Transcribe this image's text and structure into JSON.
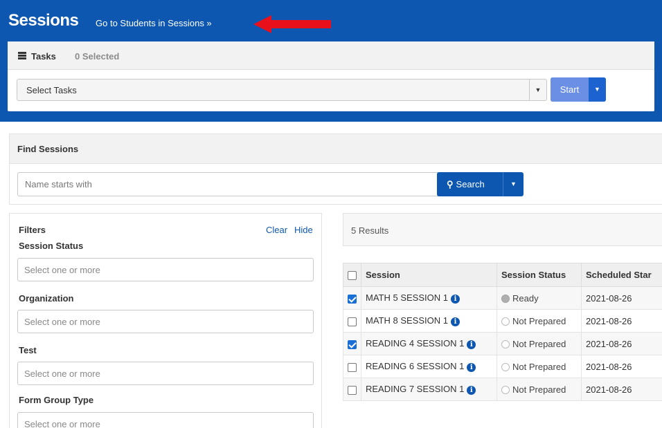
{
  "header": {
    "title": "Sessions",
    "goto_link": "Go to Students in Sessions »",
    "accent_color": "#0d57b0",
    "arrow_color": "#e8101a"
  },
  "tasks": {
    "label": "Tasks",
    "selected_count": "0 Selected",
    "select_value": "Select Tasks",
    "start_label": "Start"
  },
  "find": {
    "title": "Find Sessions",
    "search_placeholder": "Name starts with",
    "search_label": "Search"
  },
  "filters": {
    "title": "Filters",
    "clear_label": "Clear",
    "hide_label": "Hide",
    "groups": [
      {
        "label": "Session Status",
        "placeholder": "Select one or more"
      },
      {
        "label": "Organization",
        "placeholder": "Select one or more"
      },
      {
        "label": "Test",
        "placeholder": "Select one or more"
      },
      {
        "label": "Form Group Type",
        "placeholder": "Select one or more"
      }
    ]
  },
  "results": {
    "count_label": "5 Results",
    "columns": [
      "Session",
      "Session Status",
      "Scheduled Star"
    ],
    "rows": [
      {
        "checked": true,
        "session": "MATH 5 SESSION 1",
        "status": "Ready",
        "date": "2021-08-26"
      },
      {
        "checked": false,
        "session": "MATH 8 SESSION 1",
        "status": "Not Prepared",
        "date": "2021-08-26"
      },
      {
        "checked": true,
        "session": "READING 4 SESSION 1",
        "status": "Not Prepared",
        "date": "2021-08-26"
      },
      {
        "checked": false,
        "session": "READING 6 SESSION 1",
        "status": "Not Prepared",
        "date": "2021-08-26"
      },
      {
        "checked": false,
        "session": "READING 7 SESSION 1",
        "status": "Not Prepared",
        "date": "2021-08-26"
      }
    ]
  }
}
